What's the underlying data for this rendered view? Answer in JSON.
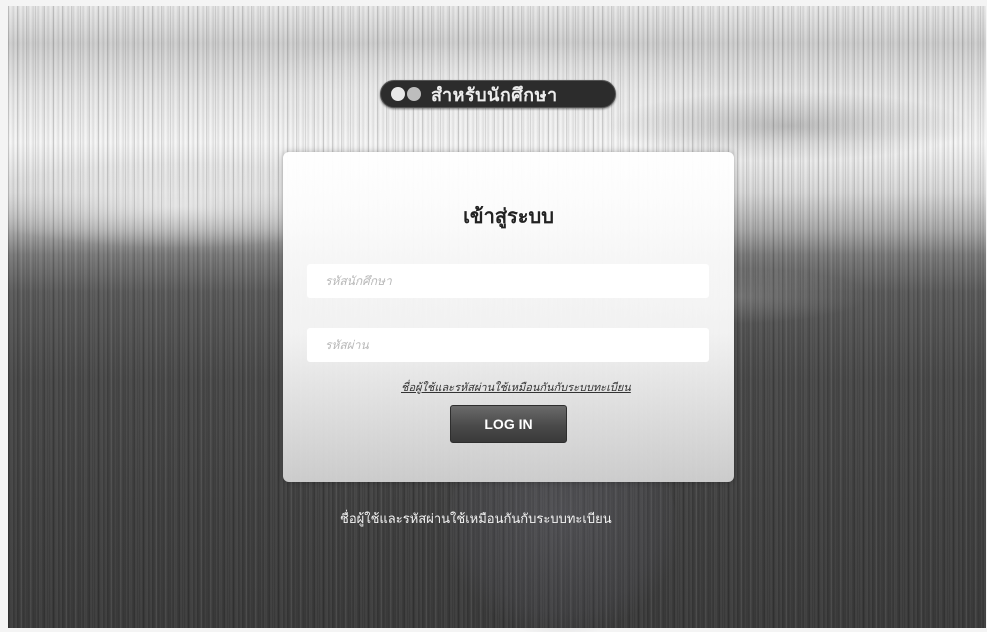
{
  "header": {
    "title": "สำหรับนักศึกษา",
    "logo_icon": "university-logo-icon"
  },
  "login": {
    "title": "เข้าสู่ระบบ",
    "username_placeholder": "รหัสนักศึกษา",
    "password_placeholder": "รหัสผ่าน",
    "hint_link": "ชื่อผู้ใช้และรหัสผ่านใช้เหมือนกันกับระบบทะเบียน",
    "button_label": "LOG IN"
  },
  "footer": {
    "note": "ชื่อผู้ใช้และรหัสผ่านใช้เหมือนกันกับระบบทะเบียน"
  }
}
